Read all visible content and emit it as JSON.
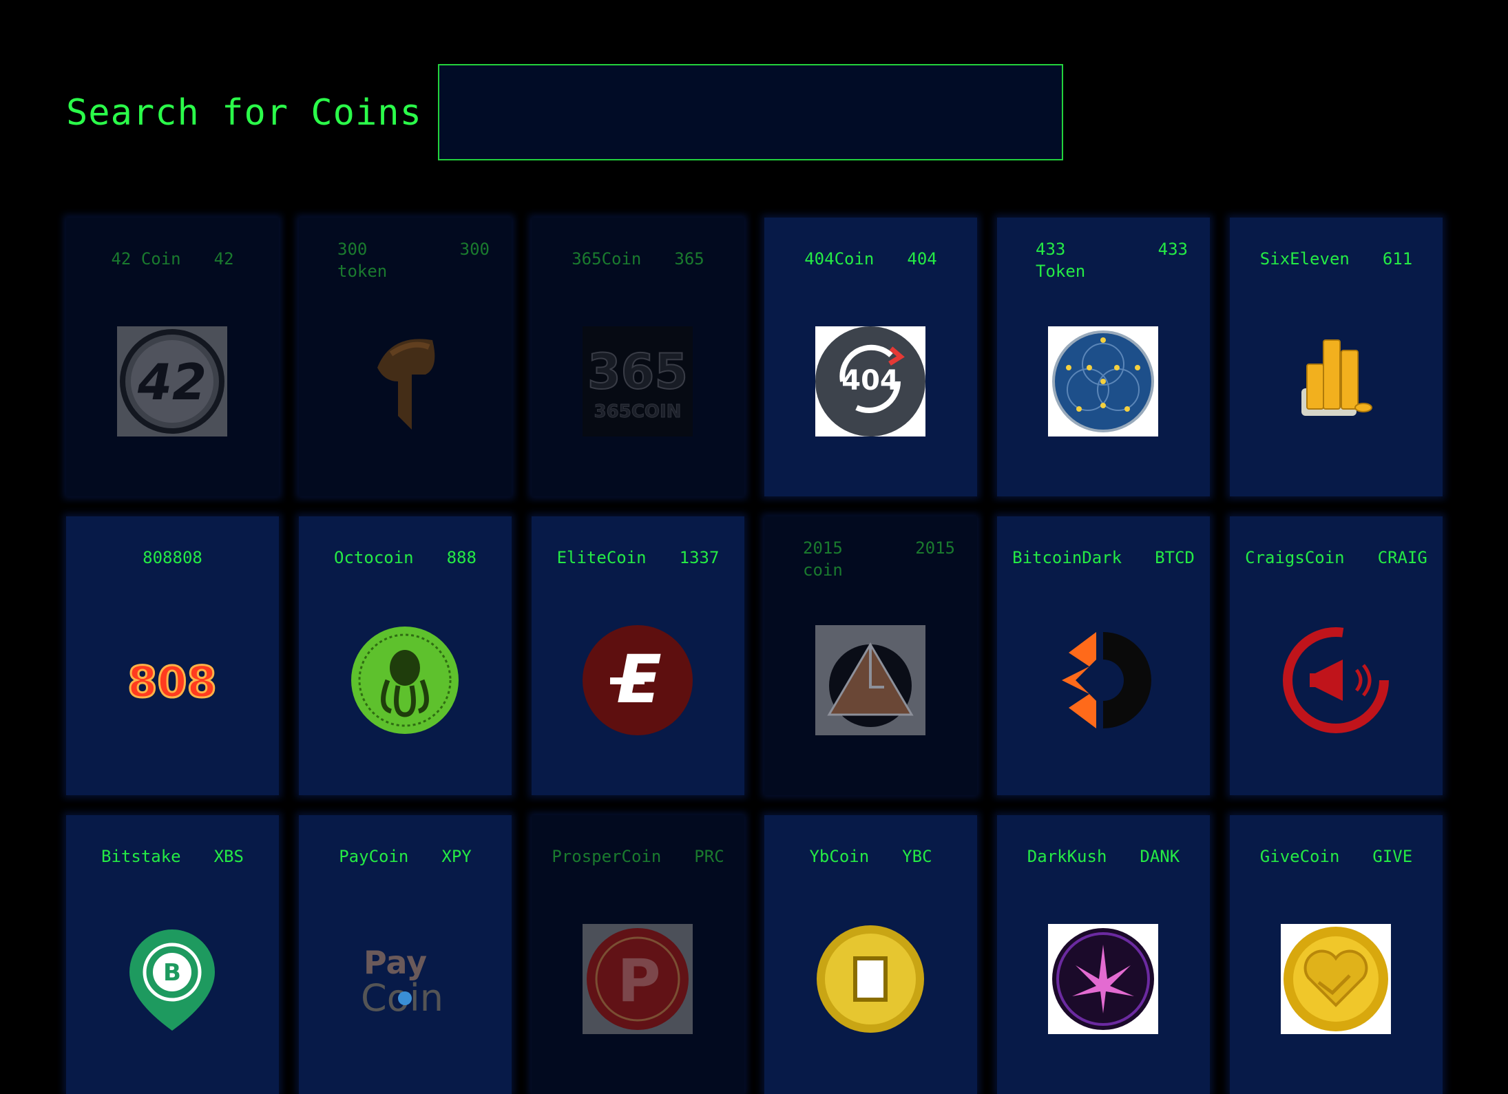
{
  "search": {
    "label": "Search for Coins",
    "value": "",
    "placeholder": ""
  },
  "coins": [
    {
      "name": "42 Coin",
      "symbol": "42",
      "icon": "coin-42-icon",
      "dim": true
    },
    {
      "name": "300\ntoken",
      "symbol": "300",
      "icon": "spartan-helmet-icon",
      "dim": true
    },
    {
      "name": "365Coin",
      "symbol": "365",
      "icon": "coin-365-icon",
      "dim": true
    },
    {
      "name": "404Coin",
      "symbol": "404",
      "icon": "coin-404-icon",
      "dim": false
    },
    {
      "name": "433\nToken",
      "symbol": "433",
      "icon": "star-circle-icon",
      "dim": false
    },
    {
      "name": "SixEleven",
      "symbol": "611",
      "icon": "coin-stacks-icon",
      "dim": false
    },
    {
      "name": "808",
      "symbol": "808",
      "icon": "text-808-icon",
      "dim": false
    },
    {
      "name": "Octocoin",
      "symbol": "888",
      "icon": "octopus-coin-icon",
      "dim": false
    },
    {
      "name": "EliteCoin",
      "symbol": "1337",
      "icon": "elite-e-icon",
      "dim": false
    },
    {
      "name": "2015\ncoin",
      "symbol": "2015",
      "icon": "pyramid-icon",
      "dim": true
    },
    {
      "name": "BitcoinDark",
      "symbol": "BTCD",
      "icon": "bitcoindark-icon",
      "dim": false
    },
    {
      "name": "CraigsCoin",
      "symbol": "CRAIG",
      "icon": "megaphone-icon",
      "dim": false
    },
    {
      "name": "Bitstake",
      "symbol": "XBS",
      "icon": "bitstake-pin-icon",
      "dim": false
    },
    {
      "name": "PayCoin",
      "symbol": "XPY",
      "icon": "paycoin-logo-icon",
      "dim": false
    },
    {
      "name": "ProsperCoin",
      "symbol": "PRC",
      "icon": "prosper-p-icon",
      "dim": true
    },
    {
      "name": "YbCoin",
      "symbol": "YBC",
      "icon": "gold-square-hole-coin-icon",
      "dim": false
    },
    {
      "name": "DarkKush",
      "symbol": "DANK",
      "icon": "leaf-orb-icon",
      "dim": false
    },
    {
      "name": "GiveCoin",
      "symbol": "GIVE",
      "icon": "handshake-heart-coin-icon",
      "dim": false
    }
  ],
  "colors": {
    "accent": "#2bff4a",
    "card": "#071a48",
    "card_dim": "#020a1f",
    "background": "#000000"
  }
}
